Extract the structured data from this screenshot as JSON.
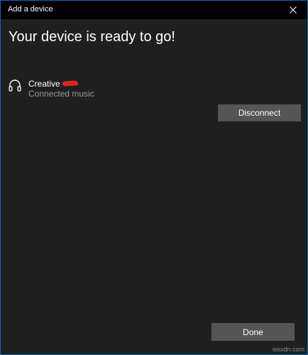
{
  "window": {
    "title": "Add a device"
  },
  "main": {
    "heading": "Your device is ready to go!"
  },
  "device": {
    "icon": "headphones-icon",
    "name": "Creative",
    "status": "Connected music"
  },
  "actions": {
    "disconnect_label": "Disconnect",
    "done_label": "Done"
  },
  "watermark": "wsxdn.com",
  "colors": {
    "background": "#1f1f1f",
    "titlebar": "#000000",
    "button": "#555555",
    "text": "#ffffff",
    "secondary_text": "#9a9a9a",
    "window_border": "#0f64c8"
  }
}
